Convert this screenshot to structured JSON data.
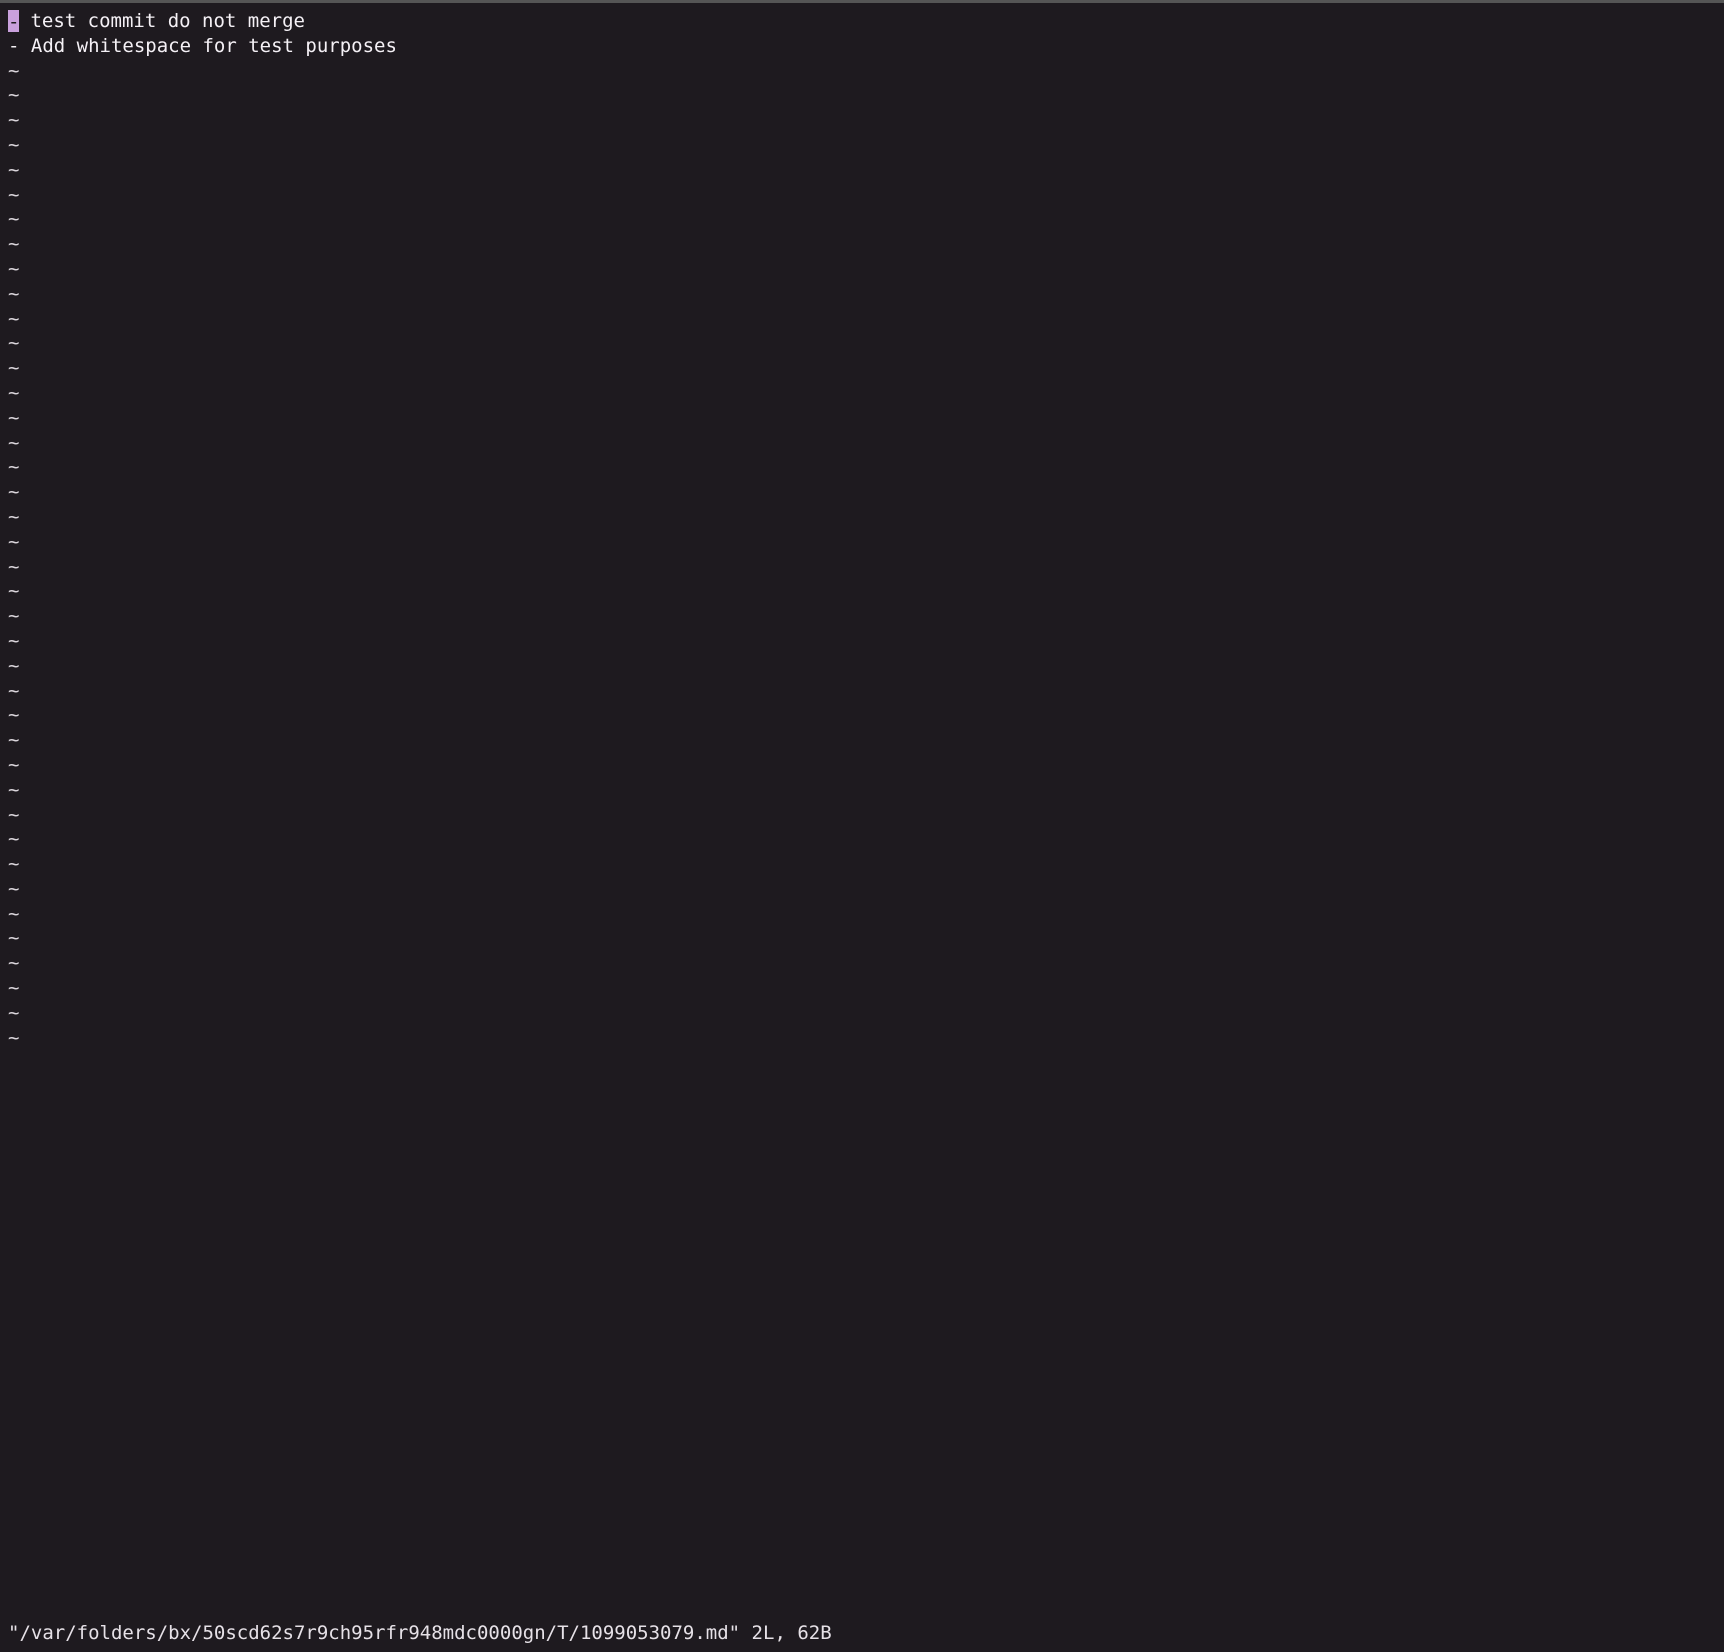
{
  "buffer": {
    "lines": [
      {
        "prefix_cursor": true,
        "prefix": "-",
        "text": " test commit do not merge"
      },
      {
        "prefix_cursor": false,
        "prefix": "-",
        "text": " Add whitespace for test purposes"
      }
    ],
    "empty_line_marker": "~",
    "empty_line_count": 40
  },
  "status": {
    "filepath": "\"/var/folders/bx/50scd62s7r9ch95rfr948mdc0000gn/T/1099053079.md\"",
    "line_count": "2L",
    "byte_count": "62B"
  }
}
